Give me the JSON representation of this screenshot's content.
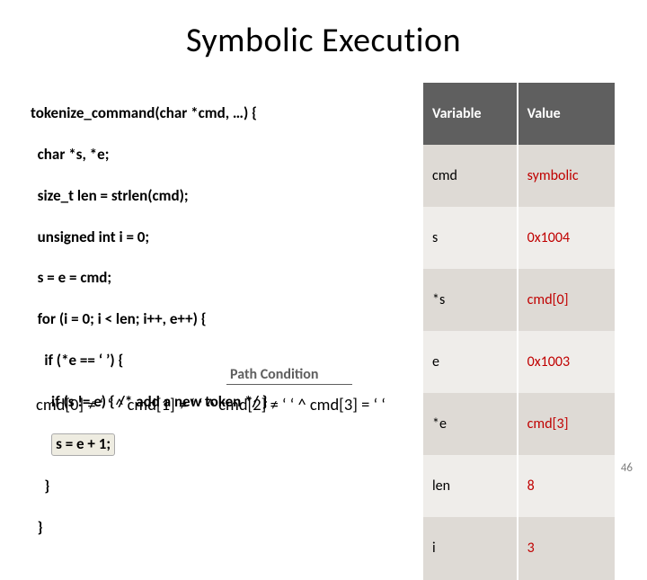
{
  "title": "Symbolic Execution",
  "code": {
    "l0": "tokenize_command(char *cmd, …) {",
    "l1": "  char *s, *e;",
    "l2": "  size_t len = strlen(cmd);",
    "l3": "  unsigned int i = 0;",
    "l4": "  s = e = cmd;",
    "l5": "  for (i = 0; i < len; i++, e++) {",
    "l6": "    if (*e == ‘ ’) {",
    "l7": "      if (s != e) { /* add a new token */ }",
    "l8": "s = e + 1;",
    "l9": "    }",
    "l10": "  }"
  },
  "table": {
    "hdr_var": "Variable",
    "hdr_val": "Value",
    "rows": [
      {
        "var": "cmd",
        "val": "symbolic"
      },
      {
        "var": "s",
        "val": "0x1004"
      },
      {
        "var": "*s",
        "val": "cmd[0]"
      },
      {
        "var": "e",
        "val": "0x1003"
      },
      {
        "var": "*e",
        "val": "cmd[3]"
      },
      {
        "var": "len",
        "val": "8"
      },
      {
        "var": "i",
        "val": "3"
      }
    ]
  },
  "pc_label": "Path Condition",
  "path_condition": "cmd[0] ≠ ‘ ‘ ^ cmd[1] ≠ ‘ ‘ ^ cmd[2] ≠ ‘ ‘ ^ cmd[3] = ‘ ‘",
  "page_number": "46"
}
